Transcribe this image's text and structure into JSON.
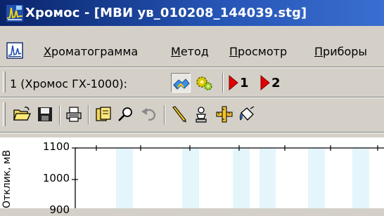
{
  "window": {
    "title": "Хромос - [МВИ ув_010208_144039.stg]",
    "icon": "chromatograph-app-icon"
  },
  "menubar": {
    "doc_icon": "chromatogram-doc-icon",
    "items": [
      {
        "label": "Хроматограмма",
        "underline": "Х",
        "rest": "роматограмма"
      },
      {
        "label": "Метод",
        "underline": "М",
        "rest": "етод"
      },
      {
        "label": "Просмотр",
        "underline": "П",
        "rest": "росмотр"
      },
      {
        "label": "Приборы",
        "underline": "П",
        "rest": "риборы"
      }
    ]
  },
  "device_toolbar": {
    "device_label": "1 (Хромос ГХ-1000):",
    "buttons": [
      {
        "name": "handshake-connect-icon",
        "pressed": true
      },
      {
        "name": "gear-settings-icon",
        "pressed": false
      },
      {
        "name": "run-channel-1-icon",
        "label": "1"
      },
      {
        "name": "run-channel-2-icon",
        "label": "2"
      }
    ],
    "channel_labels": [
      "1",
      "2"
    ],
    "accent_run": "#e00000"
  },
  "main_toolbar": {
    "buttons": [
      "open-folder-icon",
      "save-disk-icon",
      "print-icon",
      "copy-pages-icon",
      "zoom-magnifier-icon",
      "undo-icon",
      "pencil-icon",
      "person-stamp-icon",
      "ruler-cross-icon",
      "paint-bucket-icon"
    ]
  },
  "chart_data": {
    "type": "line",
    "title": "",
    "ylabel": "Отклик, мВ",
    "xlabel": "",
    "y_ticks": [
      1100,
      1000,
      900
    ],
    "ylim": [
      900,
      1100
    ],
    "grid": false,
    "series": []
  },
  "colors": {
    "face": "#d4d0c8",
    "title_bar_start": "#0a246a",
    "title_bar_end": "#3a6ed0",
    "stripe": "#e4f6fb"
  }
}
